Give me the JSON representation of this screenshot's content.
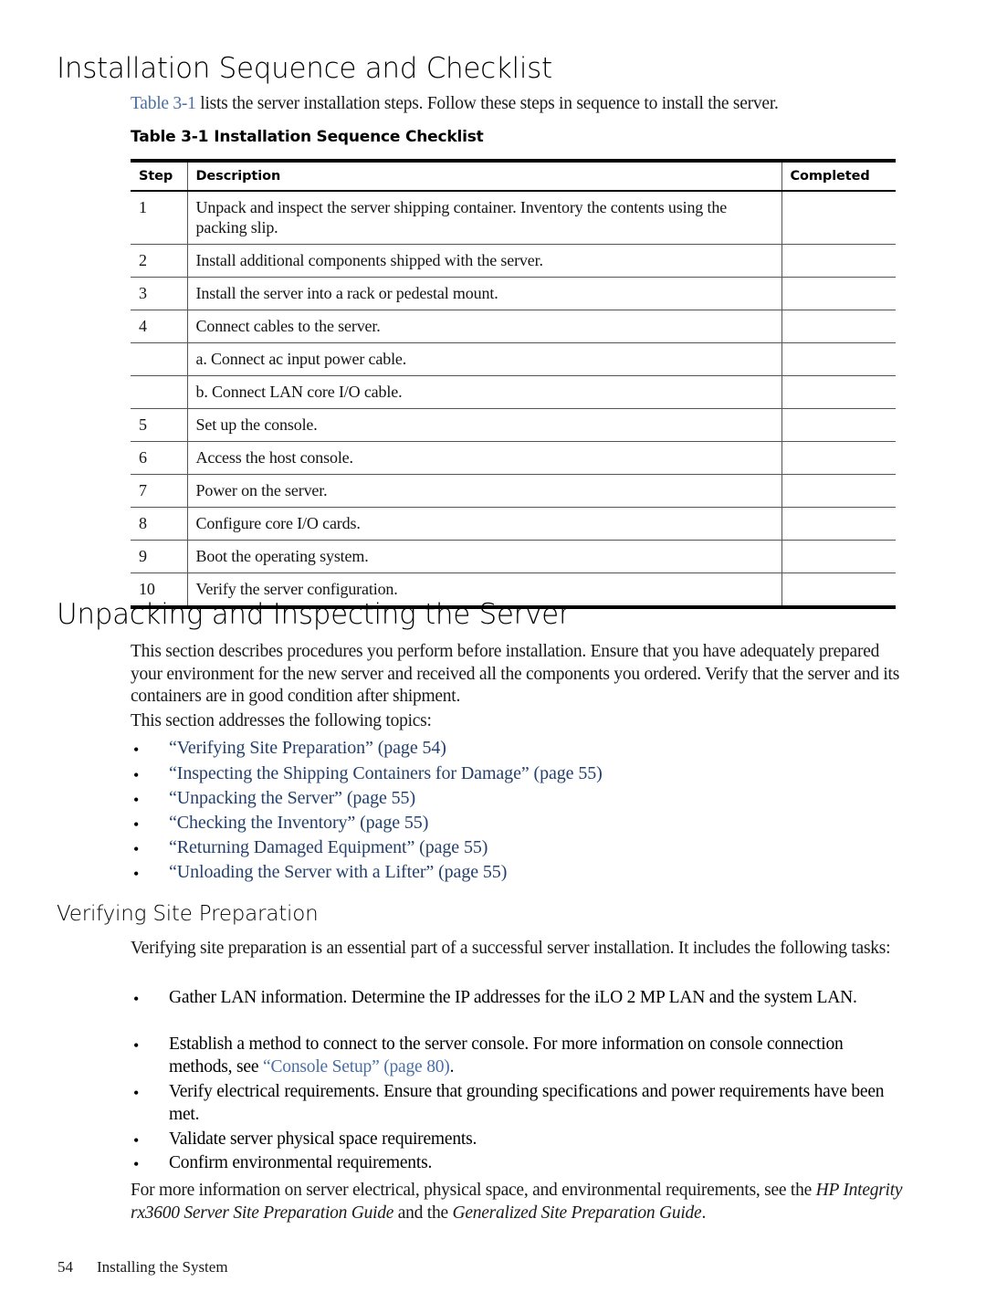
{
  "document": {
    "footer": {
      "page_number": "54",
      "chapter_title": "Installing the System"
    }
  },
  "section_installation_sequence": {
    "heading": "Installation Sequence and Checklist",
    "intro": {
      "link_text": "Table 3-1",
      "rest": " lists the server installation steps. Follow these steps in sequence to install the server."
    },
    "table_caption": {
      "label": "Table  3-1",
      "title": "Installation Sequence Checklist"
    },
    "table": {
      "columns": [
        "Step",
        "Description",
        "Completed"
      ],
      "rows": [
        {
          "step": "1",
          "description": "Unpack and inspect the server shipping container. Inventory the contents using the packing slip.",
          "completed": ""
        },
        {
          "step": "2",
          "description": "Install additional components shipped with the server.",
          "completed": ""
        },
        {
          "step": "3",
          "description": "Install the server into a rack or pedestal mount.",
          "completed": ""
        },
        {
          "step": "4",
          "description": "Connect cables to the server.",
          "completed": ""
        },
        {
          "step": "",
          "description": "a. Connect ac input power cable.",
          "completed": ""
        },
        {
          "step": "",
          "description": "b. Connect LAN core I/O cable.",
          "completed": ""
        },
        {
          "step": "5",
          "description": "Set up the console.",
          "completed": ""
        },
        {
          "step": "6",
          "description": "Access the host console.",
          "completed": ""
        },
        {
          "step": "7",
          "description": "Power on the server.",
          "completed": ""
        },
        {
          "step": "8",
          "description": "Configure core I/O cards.",
          "completed": ""
        },
        {
          "step": "9",
          "description": "Boot the operating system.",
          "completed": ""
        },
        {
          "step": "10",
          "description": "Verify the server configuration.",
          "completed": ""
        }
      ]
    }
  },
  "section_unpacking": {
    "heading": "Unpacking and Inspecting the Server",
    "paragraph": "This section describes procedures you perform before installation. Ensure that you have adequately prepared your environment for the new server and received all the components you ordered. Verify that the server and its containers are in good condition after shipment.",
    "topics_intro": "This section addresses the following topics:",
    "bullet": "•",
    "topics": [
      "“Verifying Site Preparation” (page 54)",
      "“Inspecting the Shipping Containers for Damage” (page 55)",
      "“Unpacking the Server” (page 55)",
      "“Checking the Inventory” (page 55)",
      "“Returning Damaged Equipment” (page 55)",
      "“Unloading the Server with a Lifter” (page 55)"
    ]
  },
  "section_verifying_site": {
    "heading": "Verifying Site Preparation",
    "paragraph": "Verifying site preparation is an essential part of a successful server installation. It includes the following tasks:",
    "tasks": [
      {
        "text": "Gather LAN information. Determine the IP addresses for the iLO 2 MP LAN and the system LAN."
      },
      {
        "before": "Establish a method to connect to the server console. For more information on console connection methods, see ",
        "link": "“Console Setup” (page 80)",
        "after": "."
      },
      {
        "text": "Verify electrical requirements. Ensure that grounding specifications and power requirements have been met."
      },
      {
        "text": "Validate server physical space requirements."
      },
      {
        "text": "Confirm environmental requirements."
      }
    ],
    "closing": {
      "part1": "For more information on server electrical, physical space, and environmental requirements, see the ",
      "italic1": "HP Integrity rx3600 Server Site Preparation Guide",
      "part2": " and the ",
      "italic2": "Generalized Site Preparation Guide",
      "part3": "."
    }
  },
  "colors": {
    "xref_navy": "#24406b",
    "inline_link_steel": "#4a6fa5",
    "text": "#000000",
    "rule": "#555555"
  }
}
